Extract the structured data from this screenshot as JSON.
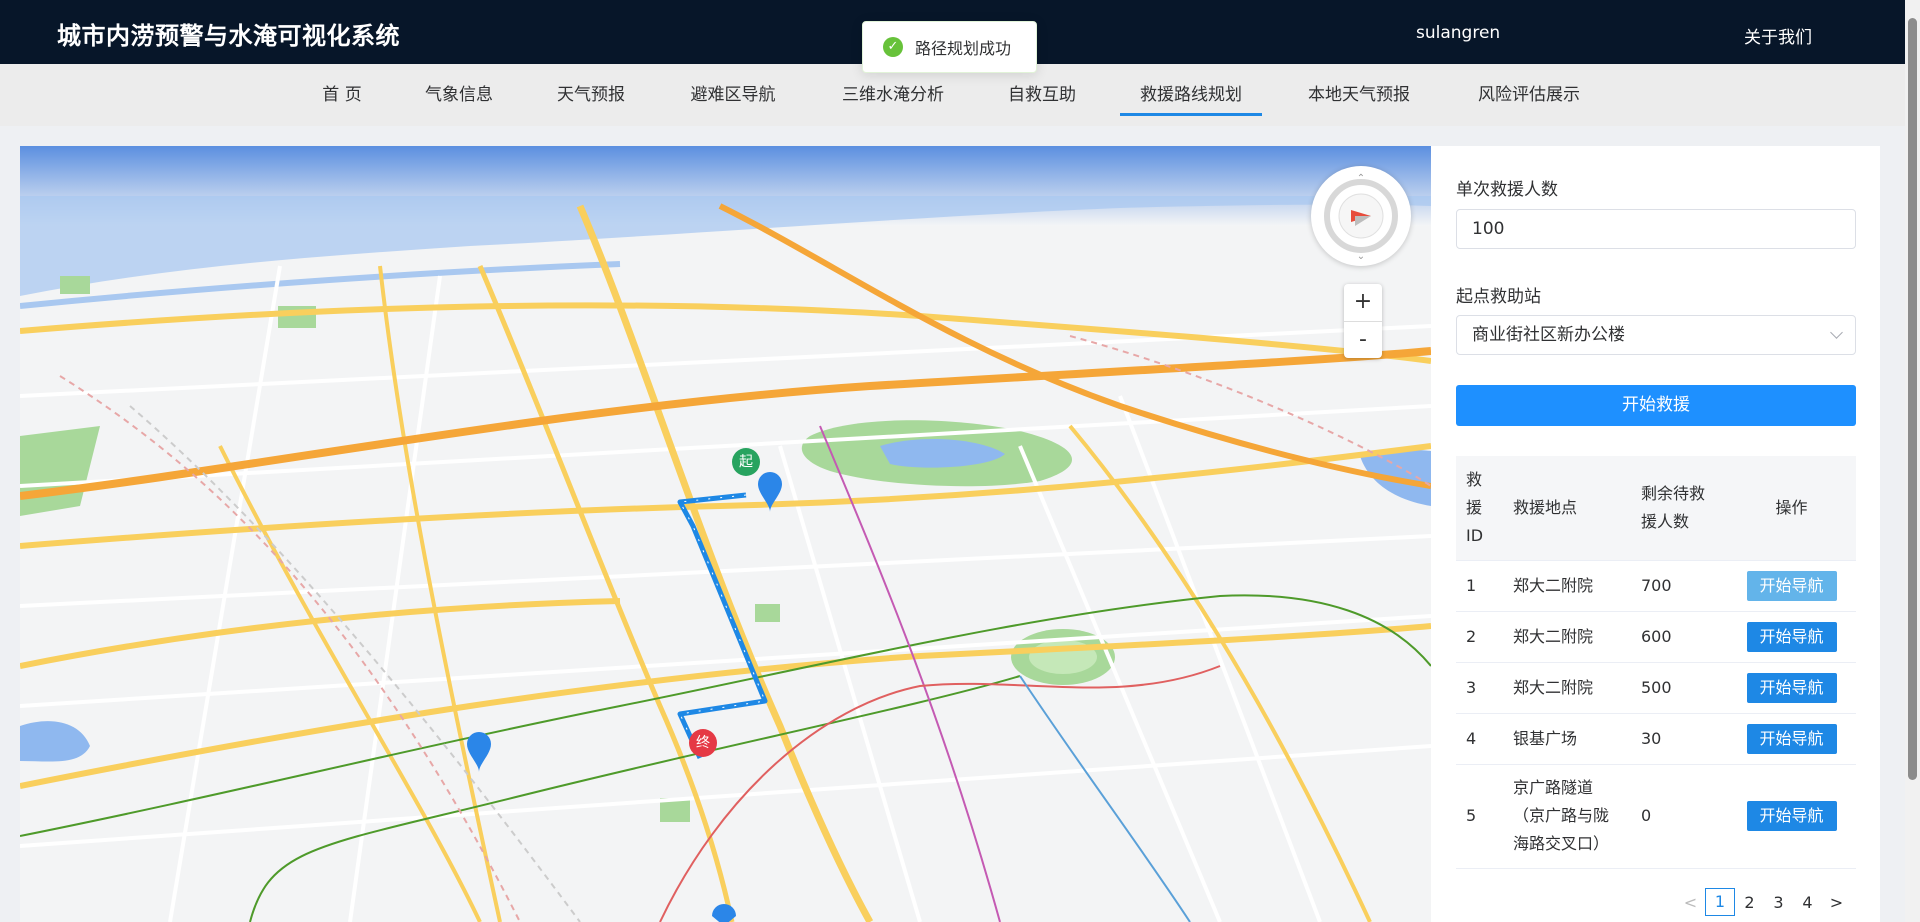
{
  "header": {
    "title": "城市内涝预警与水淹可视化系统",
    "user": "sulangren",
    "about": "关于我们"
  },
  "toast": {
    "message": "路径规划成功"
  },
  "nav": {
    "items": [
      "首 页",
      "气象信息",
      "天气预报",
      "避难区导航",
      "三维水淹分析",
      "自救互助",
      "救援路线规划",
      "本地天气预报",
      "风险评估展示"
    ],
    "active": "救援路线规划"
  },
  "map": {
    "start_marker": "起",
    "end_marker": "终",
    "zoom_in": "+",
    "zoom_out": "-"
  },
  "panel": {
    "capacity_label": "单次救援人数",
    "capacity_value": "100",
    "station_label": "起点救助站",
    "station_value": "商业街社区新办公楼",
    "start_button": "开始救援",
    "table": {
      "headers": [
        "救援ID",
        "救援地点",
        "剩余待救援人数",
        "操作"
      ],
      "rows": [
        {
          "id": "1",
          "place": "郑大二附院",
          "remaining": "700",
          "action": "开始导航"
        },
        {
          "id": "2",
          "place": "郑大二附院",
          "remaining": "600",
          "action": "开始导航"
        },
        {
          "id": "3",
          "place": "郑大二附院",
          "remaining": "500",
          "action": "开始导航"
        },
        {
          "id": "4",
          "place": "银基广场",
          "remaining": "30",
          "action": "开始导航"
        },
        {
          "id": "5",
          "place": "京广路隧道（京广路与陇海路交叉口）",
          "remaining": "0",
          "action": "开始导航"
        }
      ]
    },
    "pagination": {
      "pages": [
        "1",
        "2",
        "3",
        "4"
      ],
      "current": "1",
      "prev": "<",
      "next": ">"
    }
  },
  "colors": {
    "header_bg": "#071629",
    "primary": "#1e88e5",
    "route": "#1e88e5",
    "start_marker": "#27a35f",
    "end_marker": "#e53945",
    "toast_icon": "#67c23a"
  }
}
